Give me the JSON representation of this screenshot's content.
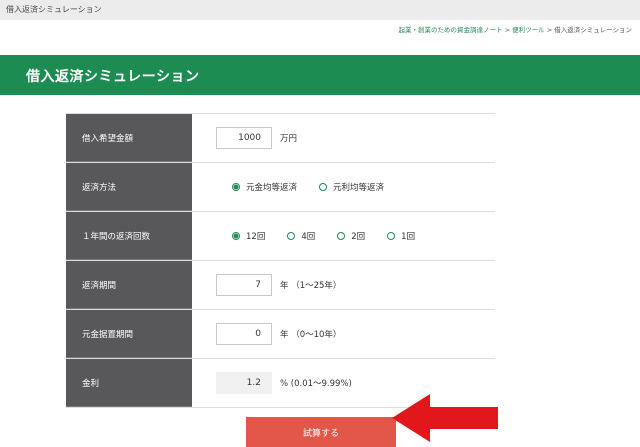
{
  "window": {
    "title": "借入返済シミュレーション"
  },
  "breadcrumb": [
    "起業・創業のための資金調達ノート",
    "便利ツール",
    "借入返済シミュレーション"
  ],
  "breadcrumb_sep": ">",
  "page_title": "借入返済シミュレーション",
  "form": {
    "loan_amount": {
      "label": "借入希望金額",
      "value": "1000",
      "unit": "万円"
    },
    "repayment_method": {
      "label": "返済方法",
      "options": [
        "元金均等返済",
        "元利均等返済"
      ],
      "selected": "元金均等返済"
    },
    "payments_per_year": {
      "label": "１年間の返済回数",
      "options": [
        "12回",
        "4回",
        "2回",
        "1回"
      ],
      "selected": "12回"
    },
    "repayment_period": {
      "label": "返済期間",
      "value": "7",
      "unit": "年 （1～25年）"
    },
    "grace_period": {
      "label": "元金据置期間",
      "value": "0",
      "unit": "年 （0～10年）"
    },
    "interest_rate": {
      "label": "金利",
      "value": "1.2",
      "unit": "% (0.01～9.99%)"
    }
  },
  "submit_label": "試算する",
  "colors": {
    "accent": "#1d8c52",
    "label_bg": "#58585a",
    "button": "#e3574b",
    "arrow": "#e2171b"
  }
}
